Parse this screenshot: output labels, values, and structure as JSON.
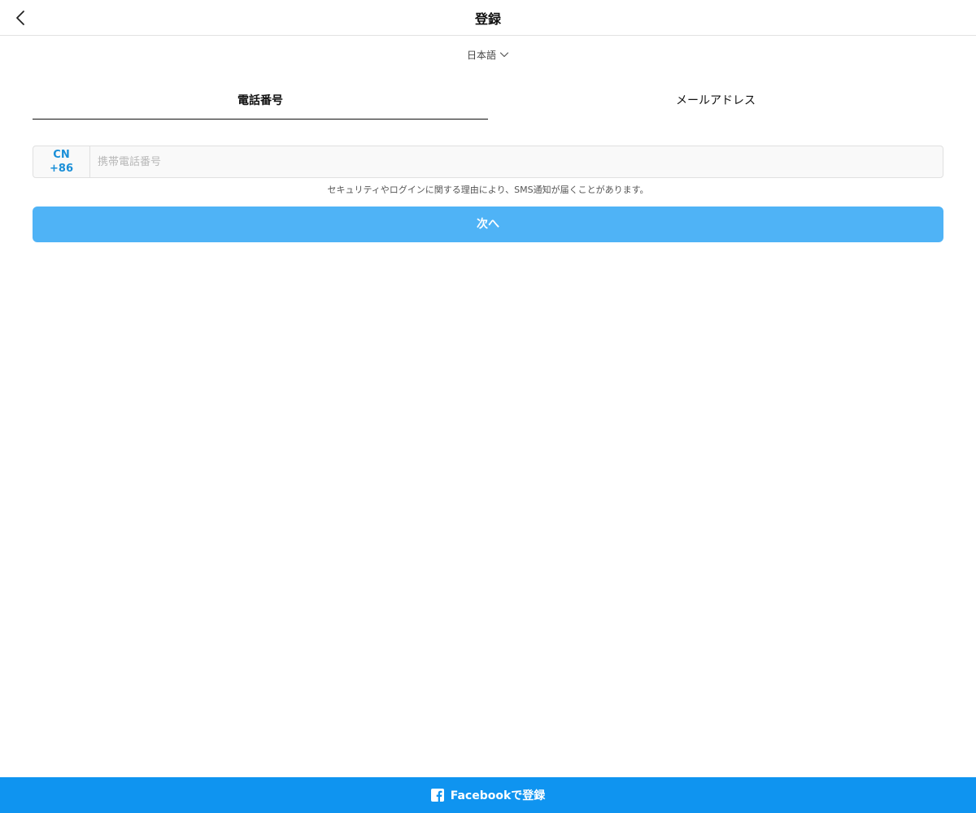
{
  "header": {
    "title": "登録",
    "back_icon": "chevron-left-icon"
  },
  "language": {
    "selected": "日本語",
    "icon": "chevron-down-icon"
  },
  "tabs": [
    {
      "label": "電話番号",
      "active": true
    },
    {
      "label": "メールアドレス",
      "active": false
    }
  ],
  "phone": {
    "country": "CN",
    "dial_code": "+86",
    "value": "",
    "placeholder": "携帯電話番号",
    "notice": "セキュリティやログインに関する理由により、SMS通知が届くことがあります。"
  },
  "next_button": {
    "label": "次へ"
  },
  "facebook": {
    "label": "Facebookで登録",
    "icon": "facebook-icon"
  },
  "colors": {
    "accent": "#1a8fd8",
    "next_button_bg": "#4fb3f6",
    "facebook_bar_bg": "#0f94f0"
  }
}
